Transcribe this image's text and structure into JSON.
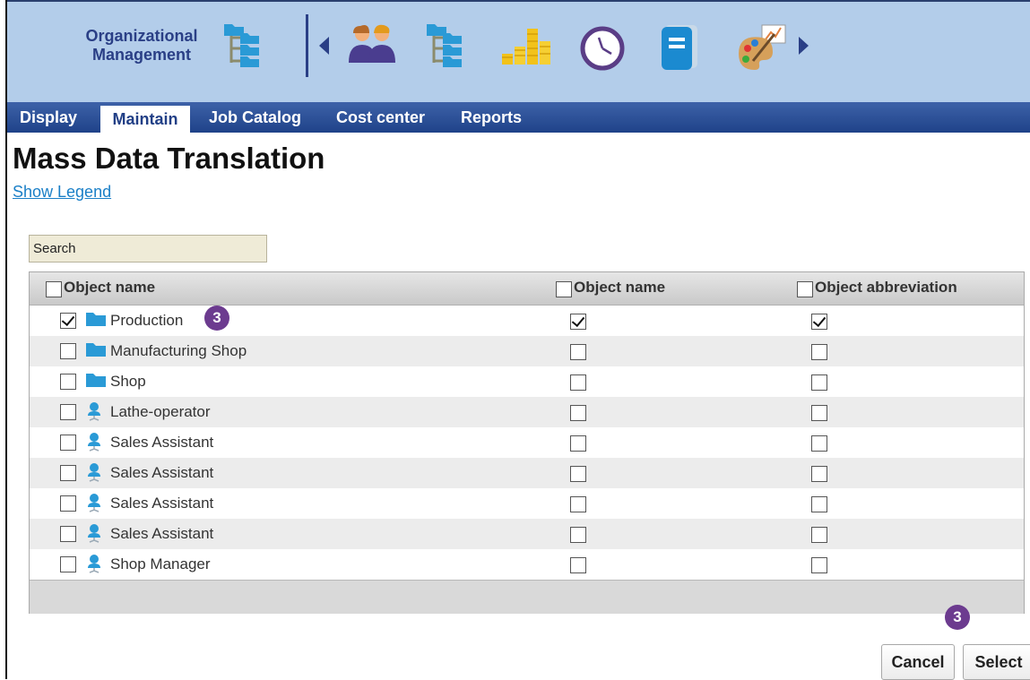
{
  "header": {
    "app_title_line1": "Organizational",
    "app_title_line2": "Management",
    "icons": [
      "org-tree-icon",
      "arrow-left-icon",
      "people-icon",
      "org-tree-icon",
      "coins-chart-icon",
      "clock-icon",
      "notebook-icon",
      "palette-icon",
      "arrow-right-icon"
    ]
  },
  "nav": {
    "tabs": [
      "Display",
      "Maintain",
      "Job Catalog",
      "Cost center",
      "Reports"
    ],
    "active": "Maintain"
  },
  "page": {
    "title": "Mass Data Translation",
    "legend_link": "Show Legend"
  },
  "search": {
    "placeholder": "Search"
  },
  "grid": {
    "columns": [
      "Object name",
      "Object name",
      "Object abbreviation"
    ],
    "rows": [
      {
        "name": "Production",
        "type": "org-unit",
        "col1": true,
        "col2": true,
        "col3": true
      },
      {
        "name": "Manufacturing Shop",
        "type": "org-unit",
        "col1": false,
        "col2": false,
        "col3": false
      },
      {
        "name": "Shop",
        "type": "org-unit",
        "col1": false,
        "col2": false,
        "col3": false
      },
      {
        "name": "Lathe-operator",
        "type": "position",
        "col1": false,
        "col2": false,
        "col3": false
      },
      {
        "name": "Sales Assistant",
        "type": "position",
        "col1": false,
        "col2": false,
        "col3": false
      },
      {
        "name": "Sales Assistant",
        "type": "position",
        "col1": false,
        "col2": false,
        "col3": false
      },
      {
        "name": "Sales Assistant",
        "type": "position",
        "col1": false,
        "col2": false,
        "col3": false
      },
      {
        "name": "Sales Assistant",
        "type": "position",
        "col1": false,
        "col2": false,
        "col3": false
      },
      {
        "name": "Shop Manager",
        "type": "position",
        "col1": false,
        "col2": false,
        "col3": false
      }
    ]
  },
  "annotations": {
    "step_row": "3",
    "step_button": "3"
  },
  "buttons": {
    "cancel": "Cancel",
    "select": "Select"
  },
  "colors": {
    "header_bg": "#b3cdea",
    "nav_bg": "#1f4289",
    "badge": "#6c3b8f",
    "link": "#1a7fc7"
  }
}
